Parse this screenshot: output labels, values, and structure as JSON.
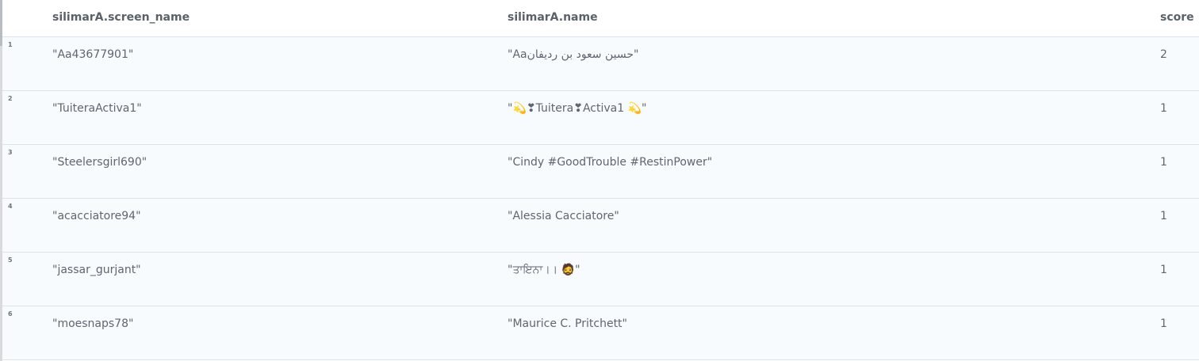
{
  "table": {
    "columns": [
      "silimarA.screen_name",
      "silimarA.name",
      "score"
    ],
    "rows": [
      {
        "index": "1",
        "screen_name": "\"Aa43677901\"",
        "name": "\"Aaحسين سعود بن رديفان\"",
        "score": "2"
      },
      {
        "index": "2",
        "screen_name": "\"TuiteraActiva1\"",
        "name": "\"💫❣Tuitera❣Activa1 💫\"",
        "score": "1"
      },
      {
        "index": "3",
        "screen_name": "\"Steelersgirl690\"",
        "name": "\"Cindy #GoodTrouble #RestinPower\"",
        "score": "1"
      },
      {
        "index": "4",
        "screen_name": "\"acacciatore94\"",
        "name": "\"Alessia Cacciatore\"",
        "score": "1"
      },
      {
        "index": "5",
        "screen_name": "\"jassar_gurjant\"",
        "name": "\"ਤਾਇਨਾ।। 🧔\"",
        "score": "1"
      },
      {
        "index": "6",
        "screen_name": "\"moesnaps78\"",
        "name": "\"Maurice C. Pritchett\"",
        "score": "1"
      }
    ]
  }
}
